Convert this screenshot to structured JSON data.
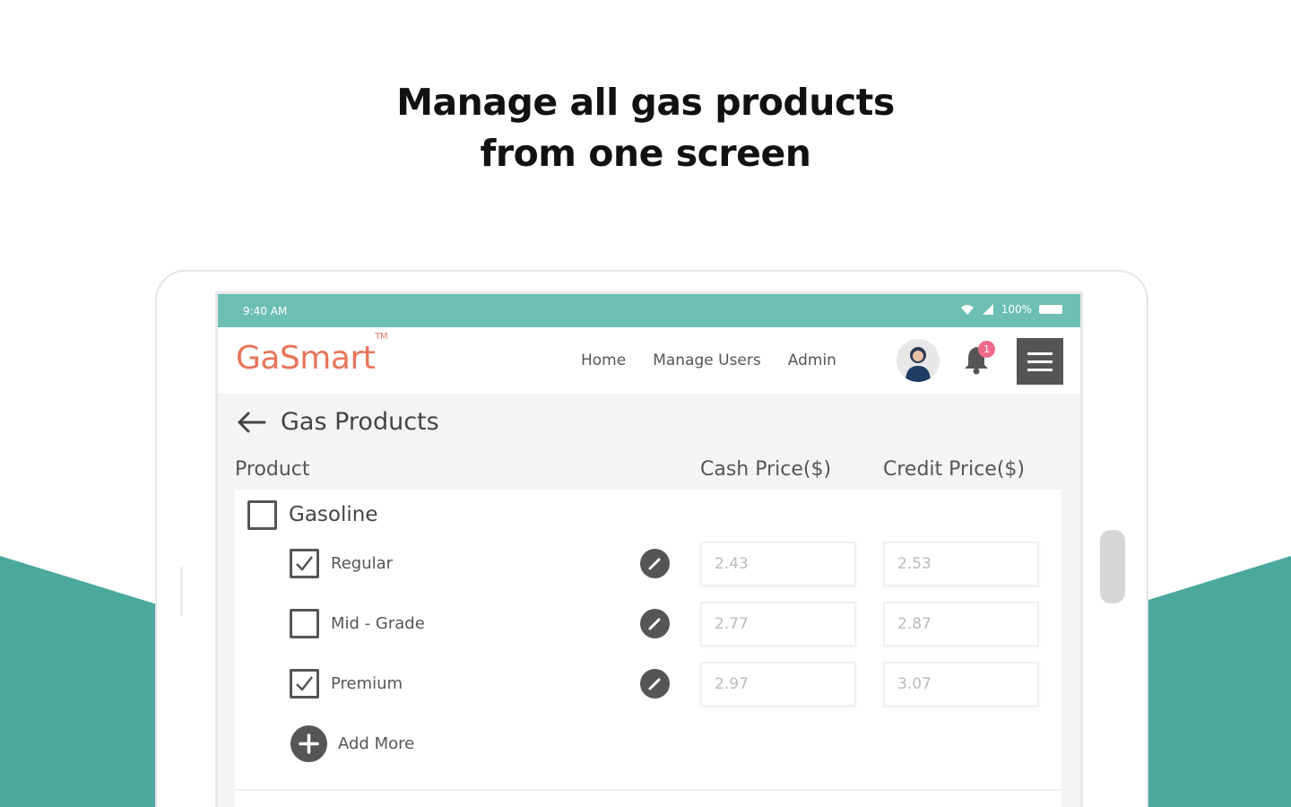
{
  "headline": {
    "line1": "Manage all gas products",
    "line2": "from one screen"
  },
  "colors": {
    "teal": "#4aa89d",
    "statusbar": "#6dbfb3",
    "logo": "#e9745a",
    "badge": "#f06a8a"
  },
  "statusbar": {
    "time": "9:40 AM",
    "battery": "100%"
  },
  "navbar": {
    "logo": "GaSmart",
    "logo_mark": "TM",
    "links": [
      "Home",
      "Manage Users",
      "Admin"
    ],
    "notification_count": "1",
    "icons": [
      "avatar",
      "bell-icon",
      "hamburger-menu-icon"
    ]
  },
  "page": {
    "title": "Gas Products",
    "columns": {
      "product": "Product",
      "cash": "Cash Price($)",
      "credit": "Credit Price($)"
    }
  },
  "products": {
    "group": {
      "label": "Gasoline",
      "checked": false
    },
    "items": [
      {
        "label": "Regular",
        "checked": true,
        "cash": "2.43",
        "credit": "2.53"
      },
      {
        "label": "Mid - Grade",
        "checked": false,
        "cash": "2.77",
        "credit": "2.87"
      },
      {
        "label": "Premium",
        "checked": true,
        "cash": "2.97",
        "credit": "3.07"
      }
    ],
    "add_more": "Add More"
  }
}
